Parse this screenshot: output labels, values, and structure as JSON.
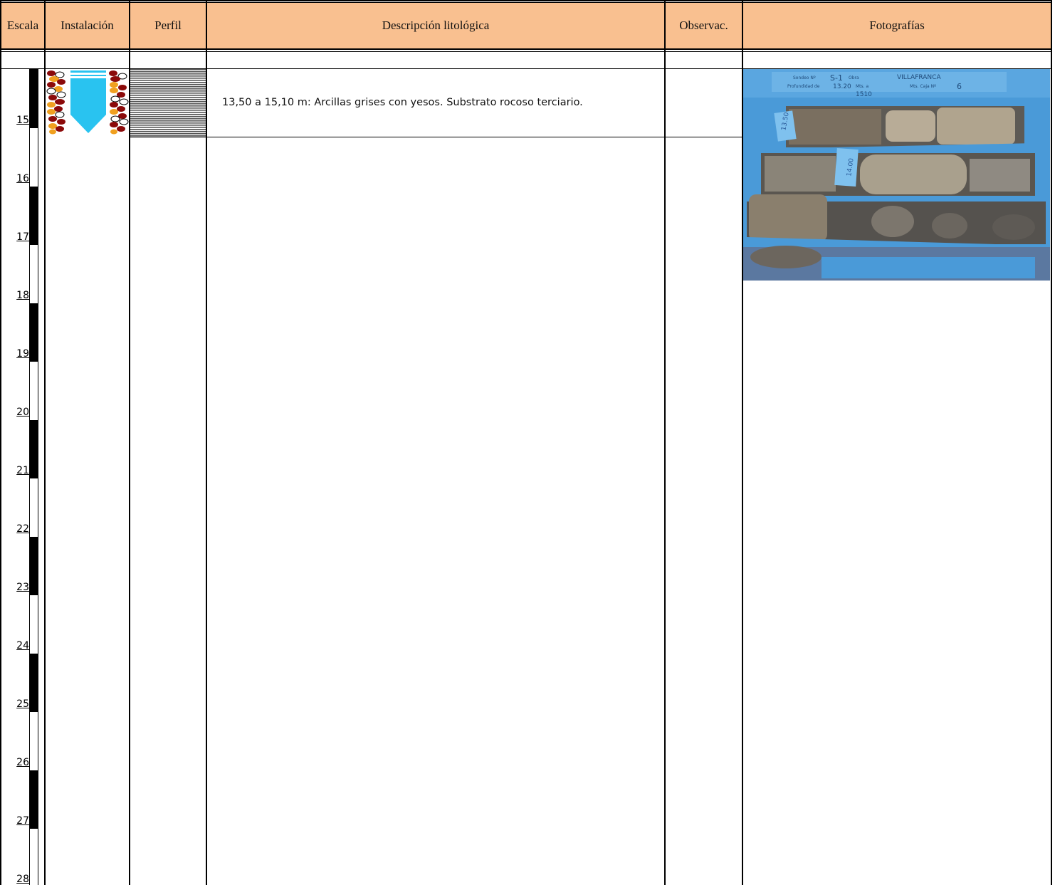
{
  "header": {
    "col_escala": "Escala",
    "col_instalacion": "Instalación",
    "col_perfil": "Perfil",
    "col_descripcion": "Descripción litológica",
    "col_observac": "Observac.",
    "col_fotografias": "Fotografías"
  },
  "scale": {
    "ticks": [
      "15",
      "16",
      "17",
      "18",
      "19",
      "20",
      "21",
      "22",
      "23",
      "24",
      "25",
      "26",
      "27",
      "28"
    ]
  },
  "layer": {
    "description": "13,50 a 15,10 m: Arcillas grises con yesos. Substrato rocoso terciario."
  },
  "photo": {
    "label_sondeo": "S-1",
    "label_obra": "VILLAFRANCA",
    "label_prof_from": "13.20",
    "label_prof_to": "1510",
    "label_caja": "6",
    "label_tag1": "13.50",
    "label_tag2": "14.00"
  },
  "colors": {
    "header_bg": "#f9c090",
    "water_blue": "#29c3f0",
    "gravel_dark": "#8b0a0a",
    "gravel_orange": "#f0a020",
    "core_box_blue": "#4a9ad8"
  }
}
